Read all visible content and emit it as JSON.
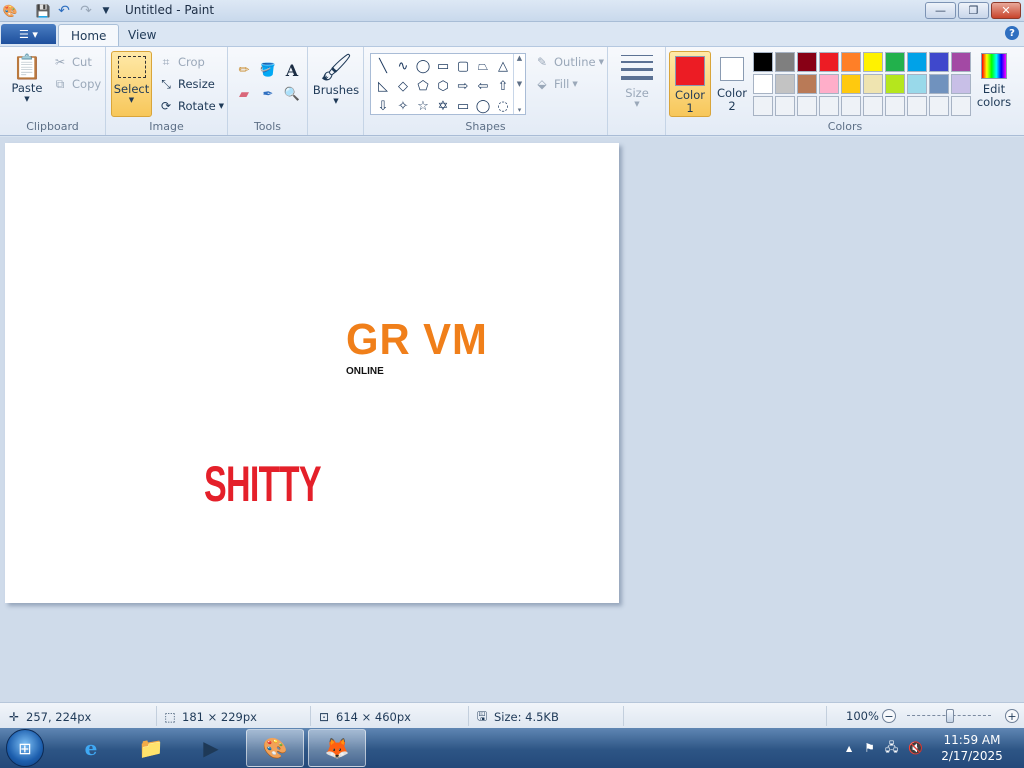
{
  "window": {
    "title": "Untitled - Paint",
    "minimize_symbol": "—",
    "maximize_symbol": "❐",
    "close_symbol": "✕"
  },
  "tabs": {
    "home": "Home",
    "view": "View"
  },
  "ribbon": {
    "clipboard": {
      "label": "Clipboard",
      "paste": "Paste",
      "cut": "Cut",
      "copy": "Copy"
    },
    "image": {
      "label": "Image",
      "select": "Select",
      "crop": "Crop",
      "resize": "Resize",
      "rotate": "Rotate"
    },
    "tools": {
      "label": "Tools"
    },
    "brushes": {
      "label": "Brushes"
    },
    "shapes": {
      "label": "Shapes",
      "outline": "Outline",
      "fill": "Fill"
    },
    "size": {
      "label": "Size"
    },
    "colors": {
      "label": "Colors",
      "color1_label": "Color",
      "color1_num": "1",
      "color2_label": "Color",
      "color2_num": "2",
      "edit_label": "Edit",
      "edit_label2": "colors",
      "color1_value": "#ec1c24",
      "color2_value": "#ffffff",
      "palette_row1": [
        "#000000",
        "#7f7f7f",
        "#880015",
        "#ed1c24",
        "#ff7f27",
        "#fff200",
        "#22b14c",
        "#00a2e8",
        "#3f48cc",
        "#a349a4"
      ],
      "palette_row2": [
        "#ffffff",
        "#c3c3c3",
        "#b97a57",
        "#ffaec9",
        "#ffc90e",
        "#efe4b0",
        "#b5e61d",
        "#99d9ea",
        "#7092be",
        "#c8bfe7"
      ],
      "palette_row3": [
        "#eef2f7",
        "#eef2f7",
        "#eef2f7",
        "#eef2f7",
        "#eef2f7",
        "#eef2f7",
        "#eef2f7",
        "#eef2f7",
        "#eef2f7",
        "#eef2f7"
      ]
    }
  },
  "canvas": {
    "text_orange": "GR VM",
    "text_small": "ONLINE",
    "text_red": "SHITTY",
    "orange_color": "#f07f1a",
    "red_color": "#e4202a"
  },
  "status": {
    "cursor_pos": "257, 224px",
    "selection_size": "181 × 229px",
    "canvas_size": "614 × 460px",
    "file_size": "Size: 4.5KB",
    "zoom": "100%"
  },
  "taskbar": {
    "time": "11:59 AM",
    "date": "2/17/2025"
  }
}
